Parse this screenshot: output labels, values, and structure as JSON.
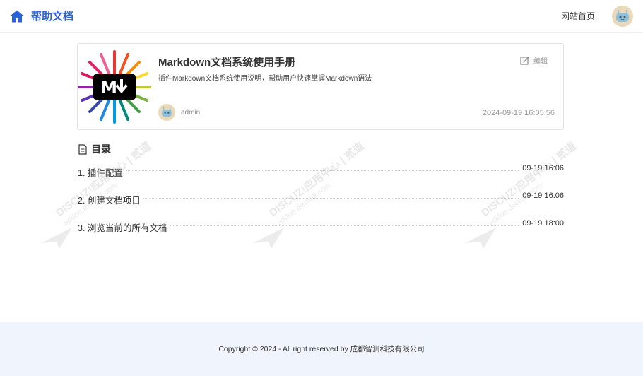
{
  "header": {
    "title": "帮助文档",
    "nav_home": "网站首页",
    "brand_color": "#2d63d8"
  },
  "card": {
    "title": "Markdown文档系统使用手册",
    "description": "插件Markdown文档系统使用说明，帮助用户快速掌握Markdown语法",
    "edit_label": "编辑",
    "author": "admin",
    "date": "2024-09-19 16:05:56",
    "thumbnail_icon": "markdown-logo"
  },
  "toc": {
    "heading": "目录",
    "items": [
      {
        "title": "1. 插件配置",
        "date": "09-19 16:06"
      },
      {
        "title": "2. 创建文档项目",
        "date": "09-19 16:06"
      },
      {
        "title": "3. 浏览当前的所有文档",
        "date": "09-19 18:00"
      }
    ]
  },
  "watermark": {
    "brand": "DISCUZ!应用中心",
    "url": "addon.dismall.com",
    "suffix": "贰道"
  },
  "footer": {
    "copyright": "Copyright © 2024 - All right reserved by 成都智测科技有限公司"
  }
}
